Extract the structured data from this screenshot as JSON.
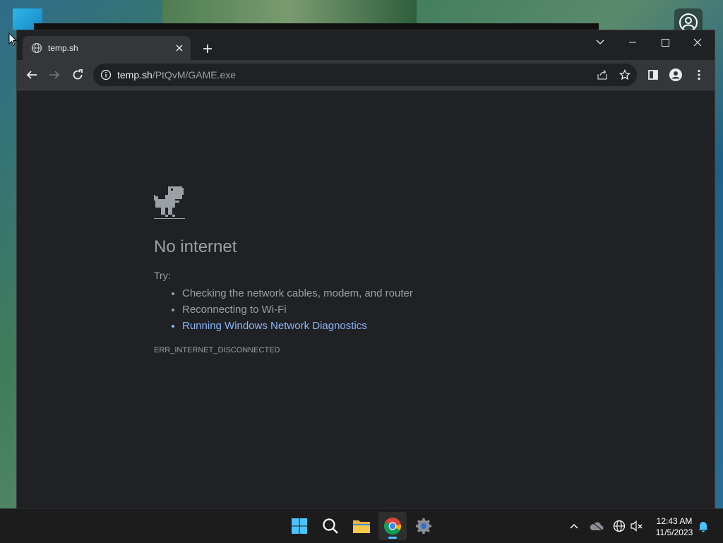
{
  "browser": {
    "tab": {
      "title": "temp.sh"
    },
    "omnibox": {
      "host": "temp.sh",
      "path": "/PtQvM/GAME.exe"
    }
  },
  "error_page": {
    "title": "No internet",
    "try_label": "Try:",
    "suggestions": [
      "Checking the network cables, modem, and router",
      "Reconnecting to Wi-Fi",
      "Running Windows Network Diagnostics"
    ],
    "error_code": "ERR_INTERNET_DISCONNECTED"
  },
  "taskbar": {
    "apps": [
      "windows-start",
      "search",
      "file-explorer",
      "chrome",
      "settings"
    ],
    "active_app": "chrome",
    "clock": {
      "time": "12:43 AM",
      "date": "11/5/2023"
    }
  },
  "colors": {
    "page_bg": "#202124",
    "link": "#8ab4f8",
    "text_muted": "#9aa0a6",
    "accent": "#4cc2ff"
  }
}
